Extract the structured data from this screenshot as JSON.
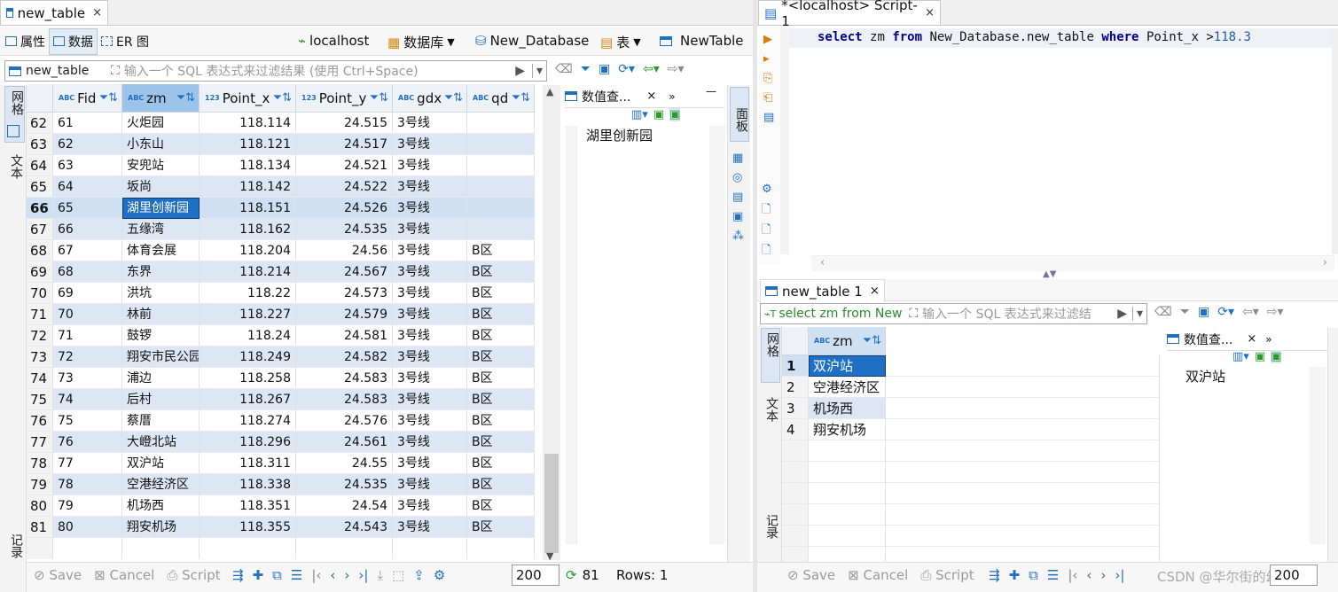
{
  "left_tab": {
    "title": "new_table",
    "close": "×"
  },
  "subtabs": {
    "props": "属性",
    "data": "数据",
    "er": "ER 图",
    "conn": "localhost",
    "db_label": "数据库",
    "db_name": "New_Database",
    "tbl_label": "表",
    "tbl_name": "NewTable"
  },
  "filter": {
    "source": "new_table",
    "placeholder": "输入一个 SQL 表达式来过滤结果 (使用 Ctrl+Space)"
  },
  "side_tabs": {
    "grid": "网格",
    "text": "文本",
    "record": "记录",
    "panel": "面板"
  },
  "columns": [
    {
      "type": "ABC",
      "name": "Fid"
    },
    {
      "type": "ABC",
      "name": "zm"
    },
    {
      "type": "123",
      "name": "Point_x"
    },
    {
      "type": "123",
      "name": "Point_y"
    },
    {
      "type": "ABC",
      "name": "gdx"
    },
    {
      "type": "ABC",
      "name": "qd"
    }
  ],
  "rows": [
    [
      "62",
      "61",
      "火炬园",
      "118.114",
      "24.515",
      "3号线",
      ""
    ],
    [
      "63",
      "62",
      "小东山",
      "118.121",
      "24.517",
      "3号线",
      ""
    ],
    [
      "64",
      "63",
      "安兜站",
      "118.134",
      "24.521",
      "3号线",
      ""
    ],
    [
      "65",
      "64",
      "坂尚",
      "118.142",
      "24.522",
      "3号线",
      ""
    ],
    [
      "66",
      "65",
      "湖里创新园",
      "118.151",
      "24.526",
      "3号线",
      ""
    ],
    [
      "67",
      "66",
      "五缘湾",
      "118.162",
      "24.535",
      "3号线",
      ""
    ],
    [
      "68",
      "67",
      "体育会展",
      "118.204",
      "24.56",
      "3号线",
      "B区"
    ],
    [
      "69",
      "68",
      "东界",
      "118.214",
      "24.567",
      "3号线",
      "B区"
    ],
    [
      "70",
      "69",
      "洪坑",
      "118.22",
      "24.573",
      "3号线",
      "B区"
    ],
    [
      "71",
      "70",
      "林前",
      "118.227",
      "24.579",
      "3号线",
      "B区"
    ],
    [
      "72",
      "71",
      "鼓锣",
      "118.24",
      "24.581",
      "3号线",
      "B区"
    ],
    [
      "73",
      "72",
      "翔安市民公园",
      "118.249",
      "24.582",
      "3号线",
      "B区"
    ],
    [
      "74",
      "73",
      "浦边",
      "118.258",
      "24.583",
      "3号线",
      "B区"
    ],
    [
      "75",
      "74",
      "后村",
      "118.267",
      "24.583",
      "3号线",
      "B区"
    ],
    [
      "76",
      "75",
      "蔡厝",
      "118.274",
      "24.576",
      "3号线",
      "B区"
    ],
    [
      "77",
      "76",
      "大嶝北站",
      "118.296",
      "24.561",
      "3号线",
      "B区"
    ],
    [
      "78",
      "77",
      "双沪站",
      "118.311",
      "24.55",
      "3号线",
      "B区"
    ],
    [
      "79",
      "78",
      "空港经济区",
      "118.338",
      "24.535",
      "3号线",
      "B区"
    ],
    [
      "80",
      "79",
      "机场西",
      "118.351",
      "24.54",
      "3号线",
      "B区"
    ],
    [
      "81",
      "80",
      "翔安机场",
      "118.355",
      "24.543",
      "3号线",
      "B区"
    ]
  ],
  "value_panel": {
    "title": "数值查...",
    "value": "湖里创新园"
  },
  "bottom_left": {
    "save": "Save",
    "cancel": "Cancel",
    "script": "Script",
    "limit": "200",
    "count": "81",
    "rows": "Rows: 1"
  },
  "script_tab": {
    "title": "*<localhost> Script-1"
  },
  "sql": {
    "kw1": "select",
    "col": "zm",
    "kw2": "from",
    "tbl": "New_Database.new_table",
    "kw3": "where",
    "cond": "Point_x >",
    "num": "118.3"
  },
  "result_tab": {
    "title": "new_table 1"
  },
  "result_filter": {
    "source": "select zm from New",
    "placeholder": "输入一个 SQL 表达式来过滤结"
  },
  "result_col": {
    "type": "ABC",
    "name": "zm"
  },
  "result_rows": [
    [
      "1",
      "双沪站"
    ],
    [
      "2",
      "空港经济区"
    ],
    [
      "3",
      "机场西"
    ],
    [
      "4",
      "翔安机场"
    ]
  ],
  "result_value": {
    "title": "数值查...",
    "value": "双沪站"
  },
  "bottom_right": {
    "save": "Save",
    "cancel": "Cancel",
    "script": "Script",
    "limit": "200",
    "watermark": "CSDN @华尔街的幻觉"
  }
}
